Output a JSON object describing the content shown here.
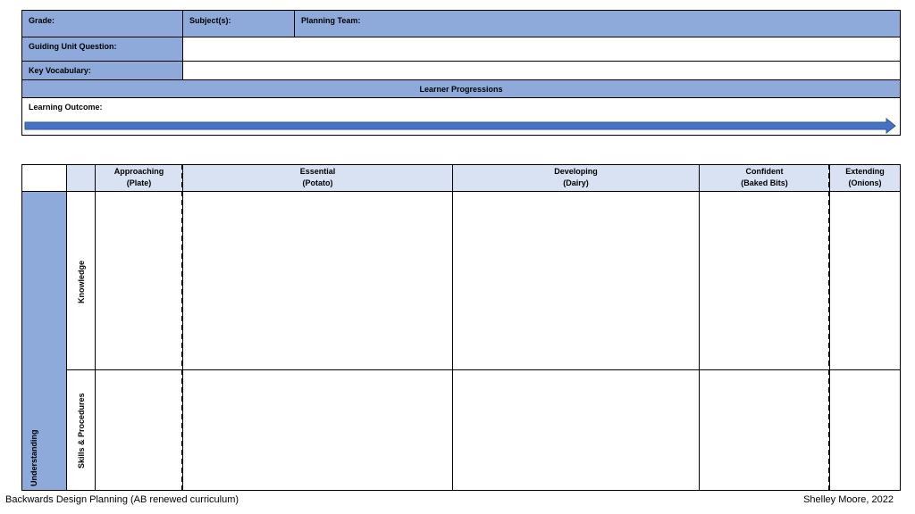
{
  "planning": {
    "grade_label": "Grade:",
    "subject_label": "Subject(s):",
    "team_label": "Planning Team:",
    "guiding_label": "Guiding Unit Question:",
    "vocab_label": "Key Vocabulary:",
    "progressions_label": "Learner Progressions",
    "outcome_label": "Learning Outcome:"
  },
  "grid": {
    "columns": [
      {
        "title": "Approaching",
        "sub": "(Plate)"
      },
      {
        "title": "Essential",
        "sub": "(Potato)"
      },
      {
        "title": "Developing",
        "sub": "(Dairy)"
      },
      {
        "title": "Confident",
        "sub": "(Baked Bits)"
      },
      {
        "title": "Extending",
        "sub": "(Onions)"
      }
    ],
    "group_label": "Understanding",
    "rows": [
      "Knowledge",
      "Skills & Procedures"
    ]
  },
  "footer": {
    "left": "Backwards Design Planning (AB renewed curriculum)",
    "right": "Shelley Moore, 2022"
  },
  "colors": {
    "header_blue": "#8eaadb",
    "light_blue": "#d9e2f3",
    "arrow_blue": "#4472c4"
  }
}
